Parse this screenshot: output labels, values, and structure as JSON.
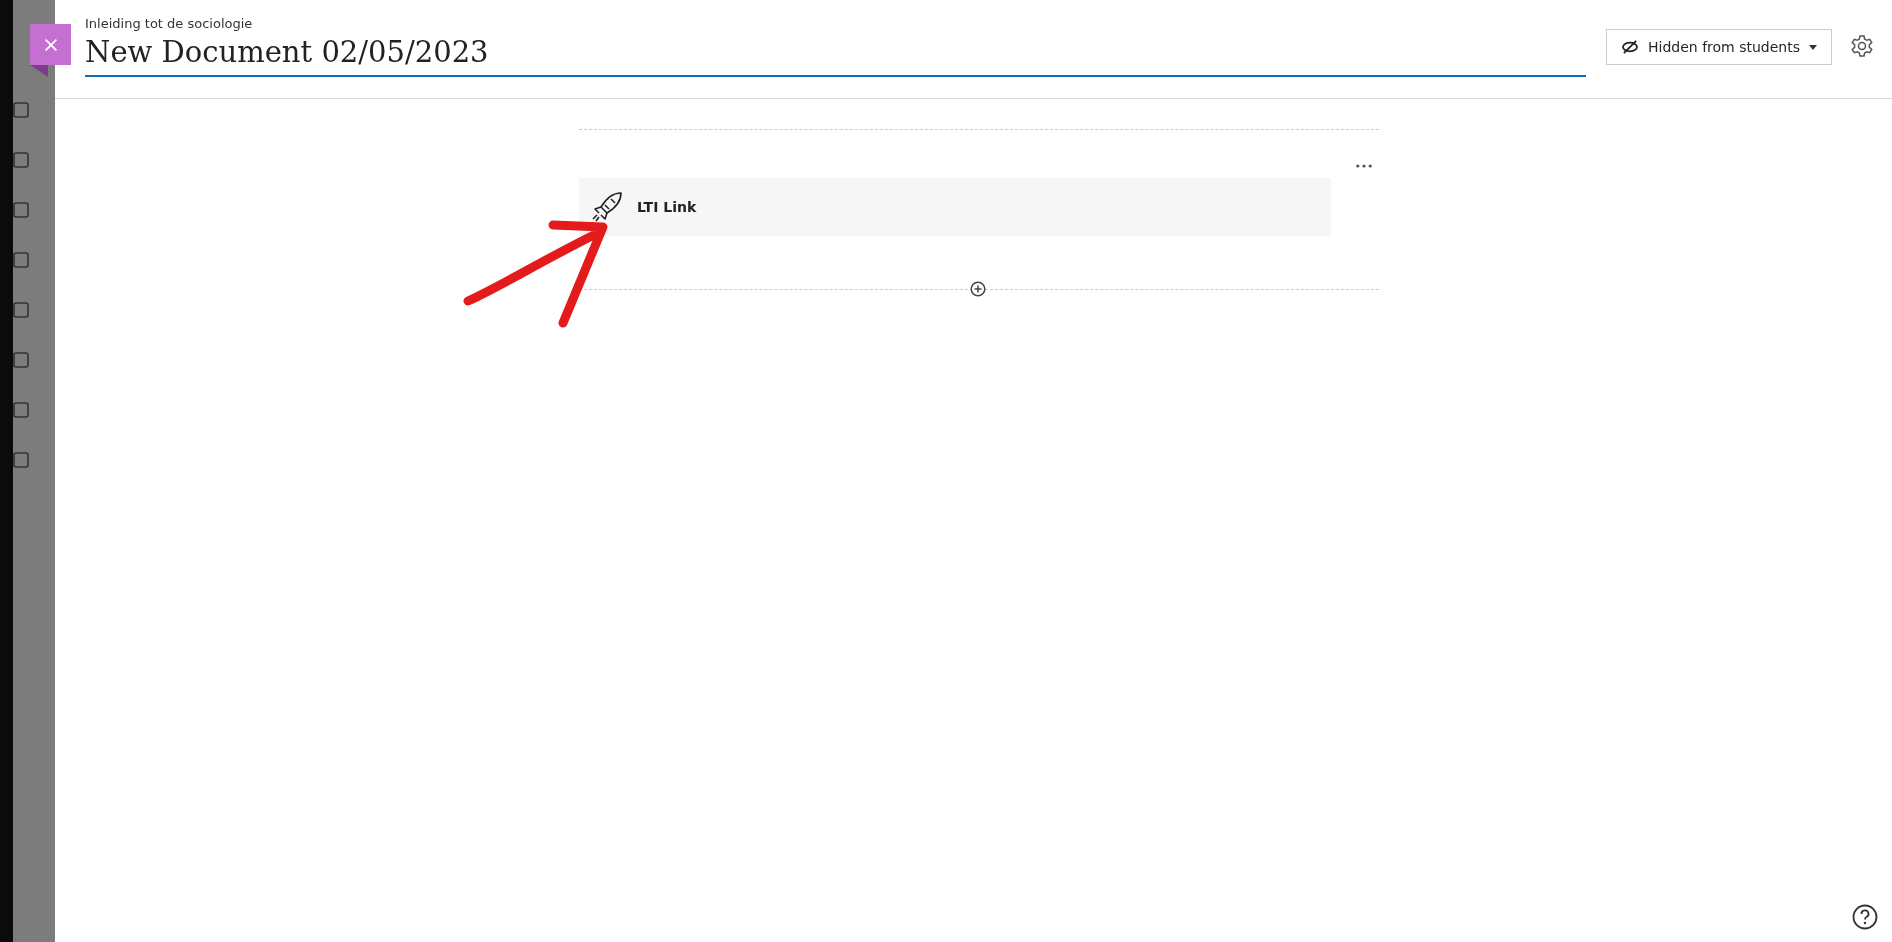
{
  "header": {
    "course": "Inleiding tot de sociologie",
    "title": "New Document 02/05/2023",
    "visibility": {
      "label": "Hidden from students"
    }
  },
  "items": [
    {
      "kind": "lti",
      "label": "LTI Link"
    }
  ]
}
